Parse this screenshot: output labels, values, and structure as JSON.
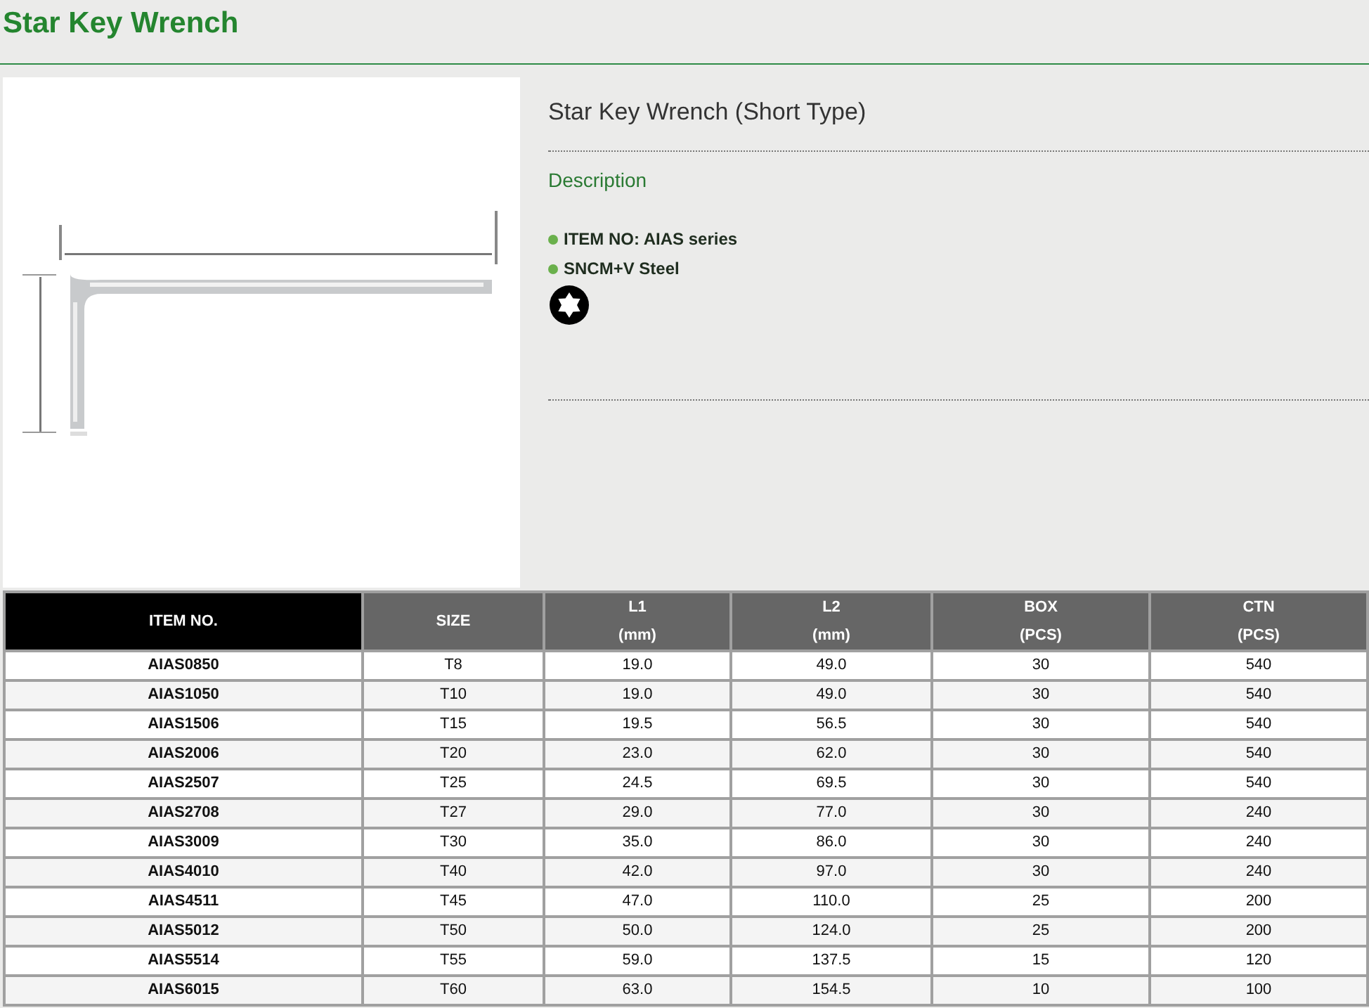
{
  "page_title": "Star Key Wrench",
  "product": {
    "title": "Star Key Wrench (Short Type)",
    "section_label": "Description",
    "features": [
      "ITEM NO: AIAS series",
      "SNCM+V Steel"
    ]
  },
  "table": {
    "columns": [
      {
        "kind": "key",
        "label": "ITEM NO."
      },
      {
        "kind": "value",
        "label": "SIZE"
      },
      {
        "kind": "value",
        "label": "L1",
        "unit": "(mm)"
      },
      {
        "kind": "value",
        "label": "L2",
        "unit": "(mm)"
      },
      {
        "kind": "value",
        "label": "BOX",
        "unit": "(PCS)"
      },
      {
        "kind": "value",
        "label": "CTN",
        "unit": "(PCS)"
      }
    ],
    "rows": [
      [
        "AIAS0850",
        "T8",
        "19.0",
        "49.0",
        "30",
        "540"
      ],
      [
        "AIAS1050",
        "T10",
        "19.0",
        "49.0",
        "30",
        "540"
      ],
      [
        "AIAS1506",
        "T15",
        "19.5",
        "56.5",
        "30",
        "540"
      ],
      [
        "AIAS2006",
        "T20",
        "23.0",
        "62.0",
        "30",
        "540"
      ],
      [
        "AIAS2507",
        "T25",
        "24.5",
        "69.5",
        "30",
        "540"
      ],
      [
        "AIAS2708",
        "T27",
        "29.0",
        "77.0",
        "30",
        "240"
      ],
      [
        "AIAS3009",
        "T30",
        "35.0",
        "86.0",
        "30",
        "240"
      ],
      [
        "AIAS4010",
        "T40",
        "42.0",
        "97.0",
        "30",
        "240"
      ],
      [
        "AIAS4511",
        "T45",
        "47.0",
        "110.0",
        "25",
        "200"
      ],
      [
        "AIAS5012",
        "T50",
        "50.0",
        "124.0",
        "25",
        "200"
      ],
      [
        "AIAS5514",
        "T55",
        "59.0",
        "137.5",
        "15",
        "120"
      ],
      [
        "AIAS6015",
        "T60",
        "63.0",
        "154.5",
        "10",
        "100"
      ]
    ]
  }
}
